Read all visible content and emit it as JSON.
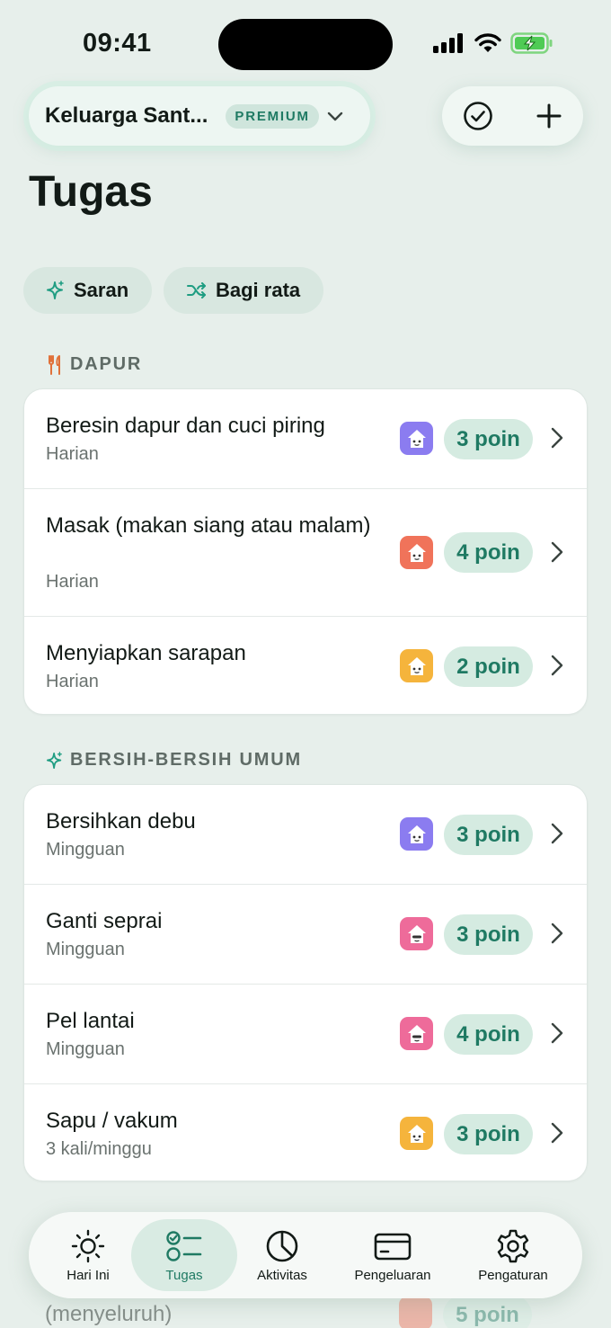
{
  "status": {
    "time": "09:41"
  },
  "header": {
    "family_name": "Keluarga Sant...",
    "badge": "PREMIUM",
    "title": "Tugas"
  },
  "chips": [
    {
      "label": "Saran",
      "icon": "sparkle-icon"
    },
    {
      "label": "Bagi rata",
      "icon": "shuffle-icon"
    }
  ],
  "sections": [
    {
      "title": "DAPUR",
      "icon": "fork-knife-icon",
      "tasks": [
        {
          "title": "Beresin dapur dan cuci piring",
          "frequency": "Harian",
          "points": "3 poin",
          "avatar_color": "#8b7cf0"
        },
        {
          "title": "Masak (makan siang atau malam)",
          "frequency": "Harian",
          "points": "4 poin",
          "avatar_color": "#f0735a"
        },
        {
          "title": "Menyiapkan sarapan",
          "frequency": "Harian",
          "points": "2 poin",
          "avatar_color": "#f5b43c"
        }
      ]
    },
    {
      "title": "BERSIH-BERSIH UMUM",
      "icon": "sparkle-icon",
      "tasks": [
        {
          "title": "Bersihkan debu",
          "frequency": "Mingguan",
          "points": "3 poin",
          "avatar_color": "#8b7cf0"
        },
        {
          "title": "Ganti seprai",
          "frequency": "Mingguan",
          "points": "3 poin",
          "avatar_color": "#ee6b9a"
        },
        {
          "title": "Pel lantai",
          "frequency": "Mingguan",
          "points": "4 poin",
          "avatar_color": "#ee6b9a"
        },
        {
          "title": "Sapu / vakum",
          "frequency": "3 kali/minggu",
          "points": "3 poin",
          "avatar_color": "#f5b43c"
        }
      ]
    }
  ],
  "partial_row": {
    "title": "(menyeluruh)",
    "points": "5 poin"
  },
  "tabbar": {
    "active": "Tugas",
    "tabs": [
      {
        "label": "Hari Ini",
        "icon": "sun-icon"
      },
      {
        "label": "Tugas",
        "icon": "checklist-icon"
      },
      {
        "label": "Aktivitas",
        "icon": "pie-chart-icon"
      },
      {
        "label": "Pengeluaran",
        "icon": "credit-card-icon"
      },
      {
        "label": "Pengaturan",
        "icon": "gear-icon"
      }
    ]
  },
  "colors": {
    "accent": "#1f7a63",
    "background": "#e7efeb",
    "points_bg": "#d5ebe1"
  }
}
